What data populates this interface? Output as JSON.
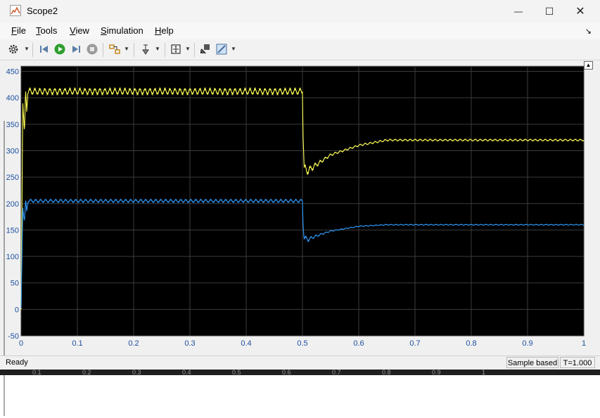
{
  "window": {
    "title": "Scope2",
    "controls": {
      "minimize": "—",
      "maximize": "☐",
      "close": "✕"
    }
  },
  "menu": [
    {
      "label": "File",
      "mnemonic": "F",
      "rest": "ile"
    },
    {
      "label": "Tools",
      "mnemonic": "T",
      "rest": "ools"
    },
    {
      "label": "View",
      "mnemonic": "V",
      "rest": "iew"
    },
    {
      "label": "Simulation",
      "mnemonic": "S",
      "rest": "imulation"
    },
    {
      "label": "Help",
      "mnemonic": "H",
      "rest": "elp"
    }
  ],
  "toolbar": {
    "icons": [
      "gear-icon",
      "step-back-icon",
      "run-icon",
      "step-forward-icon",
      "stop-icon",
      "highlight-block-icon",
      "cursor-measure-icon",
      "zoom-fit-icon",
      "restore-view-icon",
      "style-icon"
    ],
    "colors": {
      "run": "#2e9e2e",
      "stop": "#9a9a9a"
    }
  },
  "chart_data": {
    "type": "line",
    "background": "#000000",
    "grid": true,
    "grid_color": "#3c3c3c",
    "xlim": [
      0,
      1
    ],
    "ylim": [
      -50,
      460
    ],
    "xticks": [
      "0",
      "0.1",
      "0.2",
      "0.3",
      "0.4",
      "0.5",
      "0.6",
      "0.7",
      "0.8",
      "0.9",
      "1"
    ],
    "yticks": [
      "-50",
      "0",
      "50",
      "100",
      "150",
      "200",
      "250",
      "300",
      "350",
      "400",
      "450"
    ],
    "xtick_values": [
      0,
      0.1,
      0.2,
      0.3,
      0.4,
      0.5,
      0.6,
      0.7,
      0.8,
      0.9,
      1
    ],
    "ytick_values": [
      -50,
      0,
      50,
      100,
      150,
      200,
      250,
      300,
      350,
      400,
      450
    ],
    "series": [
      {
        "color": "#ffff55",
        "x": [
          0,
          0.003,
          0.006,
          0.008,
          0.01,
          0.012,
          0.5,
          0.501,
          0.503,
          0.51,
          0.52,
          0.55,
          0.6,
          0.65,
          0.7,
          1.0
        ],
        "y": [
          0,
          395,
          330,
          412,
          378,
          412,
          412,
          340,
          265,
          262,
          270,
          292,
          310,
          320,
          320,
          320
        ],
        "ripple": 6
      },
      {
        "color": "#2f9bff",
        "x": [
          0,
          0.003,
          0.006,
          0.008,
          0.01,
          0.012,
          0.5,
          0.501,
          0.503,
          0.51,
          0.52,
          0.55,
          0.6,
          0.65,
          0.7,
          1.0
        ],
        "y": [
          0,
          195,
          165,
          205,
          185,
          205,
          205,
          165,
          135,
          132,
          137,
          148,
          157,
          160,
          160,
          160
        ],
        "ripple": 3
      }
    ]
  },
  "status": {
    "left": "Ready",
    "sample_mode": "Sample based",
    "time": "T=1.000"
  },
  "background_axis": [
    "0.1",
    "0.2",
    "0.3",
    "0.4",
    "0.5",
    "0.6",
    "0.7",
    "0.8",
    "0.9",
    "1"
  ]
}
